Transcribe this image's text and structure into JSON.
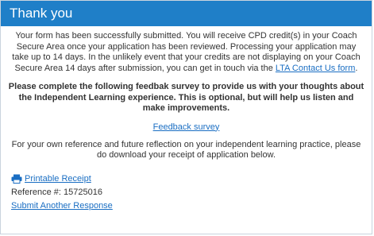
{
  "header": {
    "title": "Thank you"
  },
  "intro": {
    "text": "Your form has been successfully submitted. You will receive CPD credit(s) in your Coach Secure Area once your application has been reviewed. Processing your application may take up to 14 days. In the unlikely event that your credits are not displaying on your Coach Secure Area 14 days after submission, you can get in touch via the ",
    "link_label": "LTA Contact Us form",
    "after_link": "."
  },
  "survey": {
    "text": "Please complete the following feedbak survey to provide us with your thoughts about the Independent Learning experience. This is optional, but will help us listen and make improvements.",
    "link_label": "Feedback survey "
  },
  "reference_note": "For your own reference and future reflection on your independent learning practice, please do download your receipt of application below.",
  "receipt": {
    "printable_label": "Printable Receipt",
    "reference_label": "Reference #: 15725016",
    "submit_another_label": "Submit Another Response"
  },
  "colors": {
    "header_bg": "#1f7fc8",
    "link": "#1a6ec3"
  }
}
